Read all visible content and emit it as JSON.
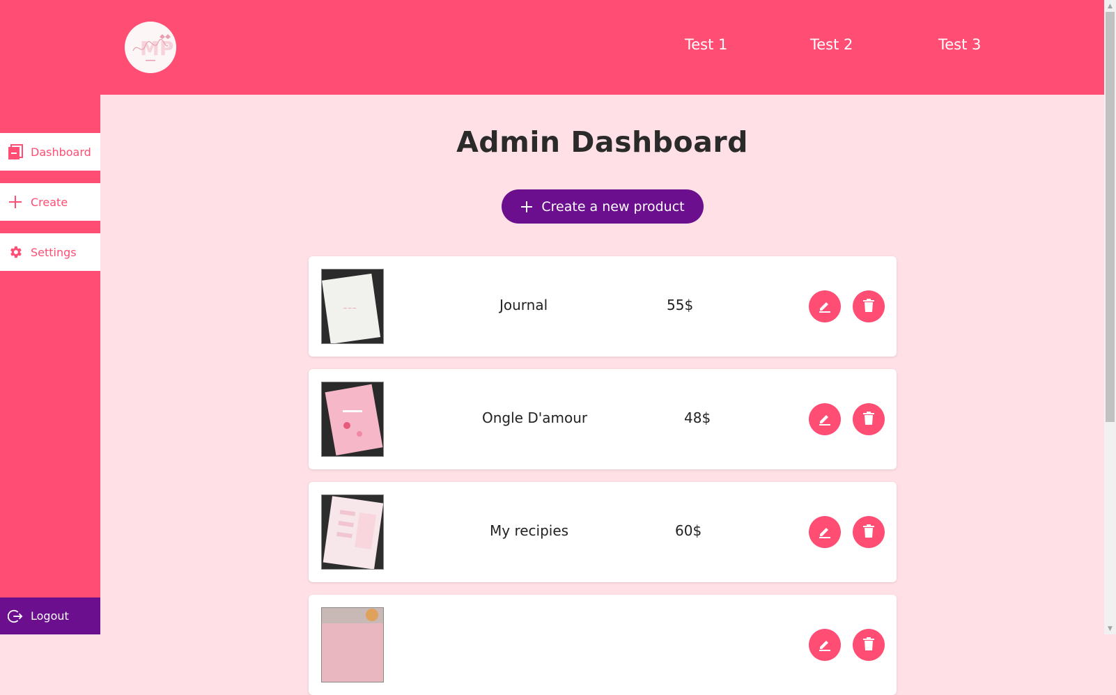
{
  "brand": {
    "logo_alt": "Mika prints logo",
    "logo_text": "Mika prints"
  },
  "nav": {
    "links": [
      "Test 1",
      "Test 2",
      "Test 3"
    ]
  },
  "sidebar": {
    "items": [
      {
        "label": "Dashboard",
        "icon": "dashboard-icon"
      },
      {
        "label": "Create",
        "icon": "plus-icon"
      },
      {
        "label": "Settings",
        "icon": "gear-icon"
      }
    ],
    "logout_label": "Logout"
  },
  "main": {
    "title": "Admin Dashboard",
    "create_button_label": "Create a new product"
  },
  "products": [
    {
      "name": "Journal",
      "price": "55$"
    },
    {
      "name": "Ongle D'amour",
      "price": "48$"
    },
    {
      "name": "My recipies",
      "price": "60$"
    },
    {
      "name": "",
      "price": ""
    }
  ],
  "colors": {
    "primary": "#ff4d73",
    "accent": "#6b0f8e",
    "background": "#ffe0e6",
    "card": "#ffffff"
  }
}
